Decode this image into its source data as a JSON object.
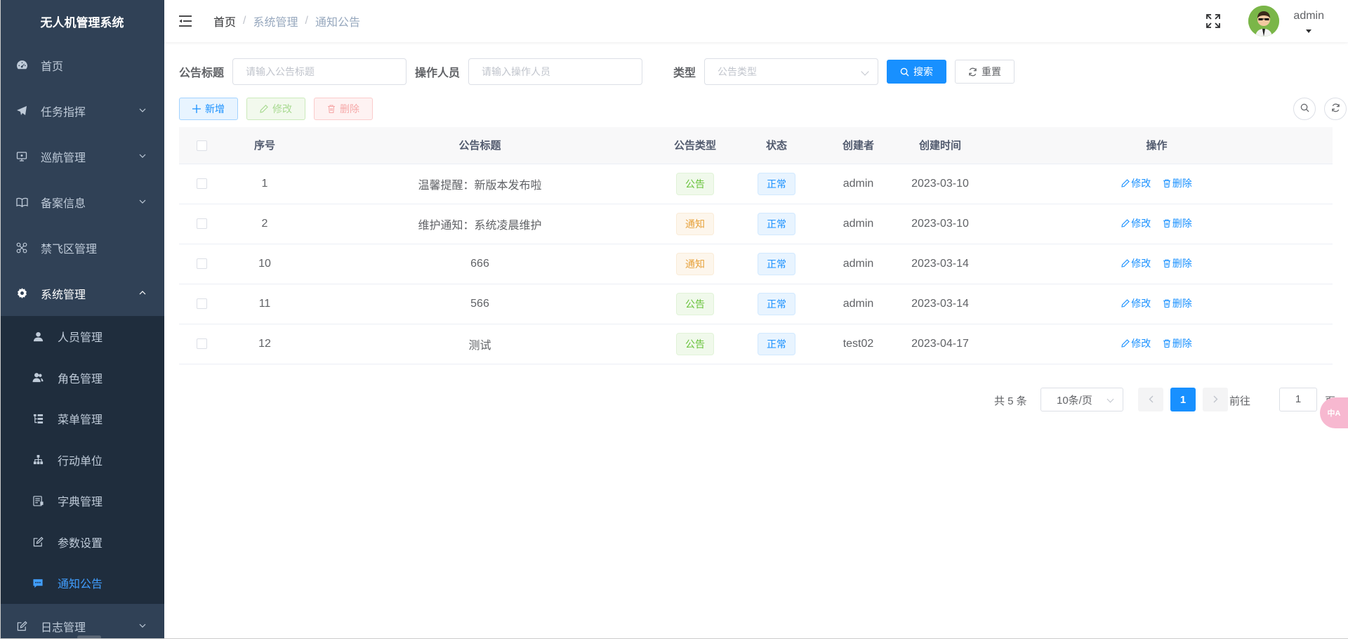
{
  "app": {
    "title": "无人机管理系统"
  },
  "sidebar": {
    "items": [
      {
        "label": "首页",
        "icon": "dashboard-icon"
      },
      {
        "label": "任务指挥",
        "icon": "send-icon"
      },
      {
        "label": "巡航管理",
        "icon": "monitor-icon"
      },
      {
        "label": "备案信息",
        "icon": "book-icon"
      },
      {
        "label": "禁飞区管理",
        "icon": "drone-icon"
      },
      {
        "label": "系统管理",
        "icon": "gear-icon"
      }
    ],
    "sub_items": [
      {
        "label": "人员管理",
        "icon": "user-icon"
      },
      {
        "label": "角色管理",
        "icon": "peoples-icon"
      },
      {
        "label": "菜单管理",
        "icon": "tree-table-icon"
      },
      {
        "label": "行动单位",
        "icon": "tree-icon"
      },
      {
        "label": "字典管理",
        "icon": "dict-icon"
      },
      {
        "label": "参数设置",
        "icon": "edit-icon"
      },
      {
        "label": "通知公告",
        "icon": "message-icon"
      }
    ],
    "last_item": {
      "label": "日志管理",
      "icon": "log-icon"
    }
  },
  "header": {
    "breadcrumb": [
      "首页",
      "系统管理",
      "通知公告"
    ],
    "user": "admin"
  },
  "search": {
    "title_label": "公告标题",
    "title_placeholder": "请输入公告标题",
    "operator_label": "操作人员",
    "operator_placeholder": "请输入操作人员",
    "type_label": "类型",
    "type_placeholder": "公告类型",
    "search_btn": "搜索",
    "reset_btn": "重置"
  },
  "toolbar": {
    "add": "新增",
    "edit": "修改",
    "delete": "删除"
  },
  "table": {
    "headers": [
      "序号",
      "公告标题",
      "公告类型",
      "状态",
      "创建者",
      "创建时间",
      "操作"
    ],
    "rows": [
      {
        "id": "1",
        "title": "温馨提醒：新版本发布啦",
        "type": "公告",
        "status": "正常",
        "creator": "admin",
        "time": "2023-03-10"
      },
      {
        "id": "2",
        "title": "维护通知：系统凌晨维护",
        "type": "通知",
        "status": "正常",
        "creator": "admin",
        "time": "2023-03-10"
      },
      {
        "id": "10",
        "title": "666",
        "type": "通知",
        "status": "正常",
        "creator": "admin",
        "time": "2023-03-14"
      },
      {
        "id": "11",
        "title": "566",
        "type": "公告",
        "status": "正常",
        "creator": "admin",
        "time": "2023-03-14"
      },
      {
        "id": "12",
        "title": "测试",
        "type": "公告",
        "status": "正常",
        "creator": "test02",
        "time": "2023-04-17"
      }
    ],
    "op_edit": "修改",
    "op_delete": "删除"
  },
  "pagination": {
    "total": "共 5 条",
    "page_size": "10条/页",
    "current": "1",
    "goto": "前往",
    "jump_value": "1",
    "page_unit": "页"
  },
  "float": {
    "label": "中A"
  },
  "colors": {
    "sidebar_bg": "#304156",
    "submenu_bg": "#1f2d3d",
    "primary": "#1890ff",
    "active_menu": "#409eff"
  }
}
